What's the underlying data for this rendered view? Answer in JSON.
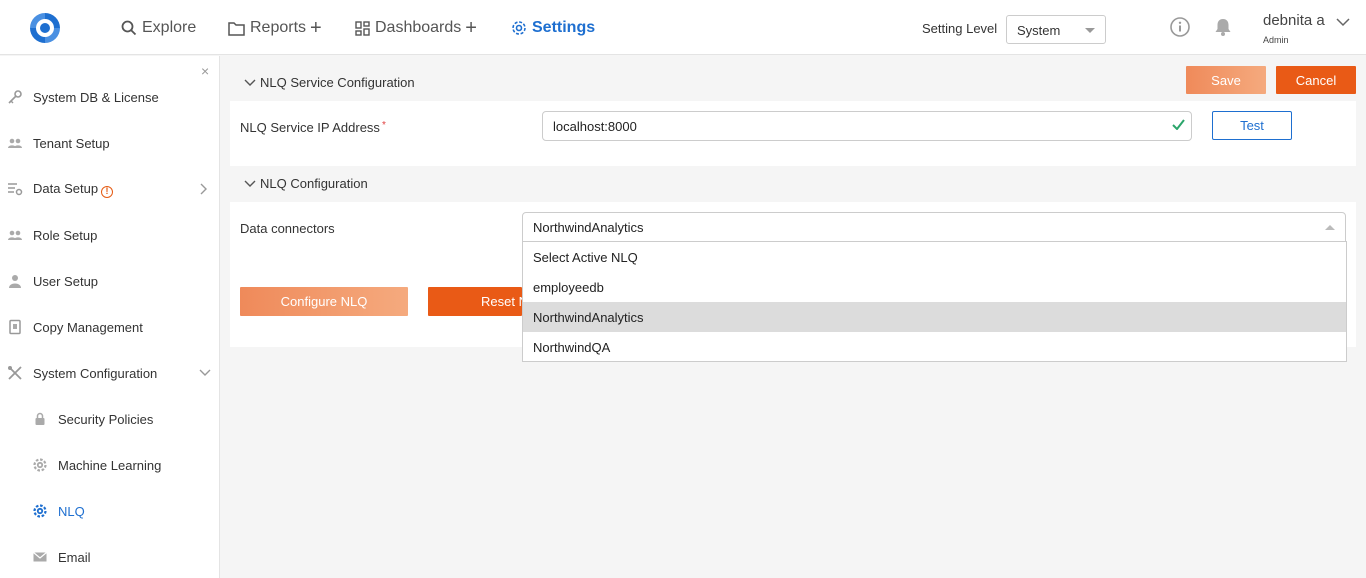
{
  "nav": {
    "explore": "Explore",
    "reports": "Reports",
    "dashboards": "Dashboards",
    "settings": "Settings",
    "plus": "+"
  },
  "header": {
    "setting_level_label": "Setting Level",
    "setting_level_value": "System",
    "user_name": "debnita a",
    "user_role": "Admin"
  },
  "sidebar": {
    "close": "×",
    "items": [
      {
        "label": "System DB & License",
        "icon": "key-icon"
      },
      {
        "label": "Tenant Setup",
        "icon": "users-icon"
      },
      {
        "label": "Data Setup",
        "icon": "data-settings-icon",
        "warning": "!"
      },
      {
        "label": "Role Setup",
        "icon": "users-icon"
      },
      {
        "label": "User Setup",
        "icon": "user-icon"
      },
      {
        "label": "Copy Management",
        "icon": "copy-icon"
      },
      {
        "label": "System Configuration",
        "icon": "tools-icon"
      },
      {
        "label": "Security Policies",
        "icon": "lock-icon"
      },
      {
        "label": "Machine Learning",
        "icon": "gear-icon"
      },
      {
        "label": "NLQ",
        "icon": "gear-icon"
      },
      {
        "label": "Email",
        "icon": "mail-icon"
      }
    ]
  },
  "actions": {
    "save": "Save",
    "cancel": "Cancel"
  },
  "nlq_service": {
    "title": "NLQ Service Configuration",
    "ip_label": "NLQ Service IP Address",
    "required_mark": "*",
    "ip_value": "localhost:8000",
    "test": "Test"
  },
  "nlq_config": {
    "title": "NLQ Configuration",
    "connectors_label": "Data connectors",
    "selected": "NorthwindAnalytics",
    "options": [
      "Select Active NLQ",
      "employeedb",
      "NorthwindAnalytics",
      "NorthwindQA"
    ],
    "configure": "Configure NLQ",
    "reset": "Reset NLQ"
  },
  "colors": {
    "accent_blue": "#1e6fd0",
    "orange": "#e95a16",
    "orange_light": "#f29a6c"
  }
}
